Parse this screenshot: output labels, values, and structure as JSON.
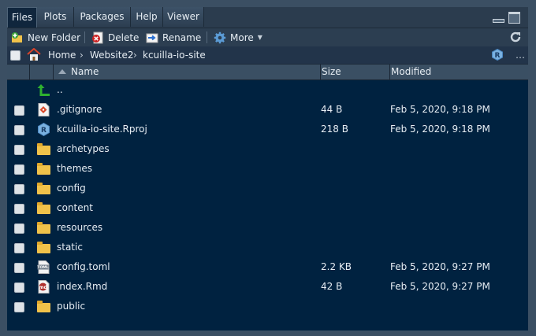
{
  "tabs": [
    {
      "label": "Files",
      "active": true
    },
    {
      "label": "Plots",
      "active": false
    },
    {
      "label": "Packages",
      "active": false
    },
    {
      "label": "Help",
      "active": false
    },
    {
      "label": "Viewer",
      "active": false
    }
  ],
  "toolbar": {
    "new_folder": "New Folder",
    "delete": "Delete",
    "rename": "Rename",
    "more": "More"
  },
  "breadcrumb": [
    "Home",
    "Website2",
    "kcuilla-io-site"
  ],
  "breadcrumb_more": "…",
  "columns": {
    "name": "Name",
    "size": "Size",
    "modified": "Modified"
  },
  "files": [
    {
      "name": "..",
      "size": "",
      "modified": "",
      "icon": "up-arrow-icon",
      "checkbox": false
    },
    {
      "name": ".gitignore",
      "size": "44 B",
      "modified": "Feb 5, 2020, 9:18 PM",
      "icon": "git-file-icon",
      "checkbox": true
    },
    {
      "name": "kcuilla-io-site.Rproj",
      "size": "218 B",
      "modified": "Feb 5, 2020, 9:18 PM",
      "icon": "rproj-file-icon",
      "checkbox": true
    },
    {
      "name": "archetypes",
      "size": "",
      "modified": "",
      "icon": "folder-icon",
      "checkbox": true
    },
    {
      "name": "themes",
      "size": "",
      "modified": "",
      "icon": "folder-icon",
      "checkbox": true
    },
    {
      "name": "config",
      "size": "",
      "modified": "",
      "icon": "folder-icon",
      "checkbox": true
    },
    {
      "name": "content",
      "size": "",
      "modified": "",
      "icon": "folder-icon",
      "checkbox": true
    },
    {
      "name": "resources",
      "size": "",
      "modified": "",
      "icon": "folder-icon",
      "checkbox": true
    },
    {
      "name": "static",
      "size": "",
      "modified": "",
      "icon": "folder-icon",
      "checkbox": true
    },
    {
      "name": "config.toml",
      "size": "2.2 KB",
      "modified": "Feb 5, 2020, 9:27 PM",
      "icon": "toml-file-icon",
      "checkbox": true
    },
    {
      "name": "index.Rmd",
      "size": "42 B",
      "modified": "Feb 5, 2020, 9:27 PM",
      "icon": "rmd-file-icon",
      "checkbox": true
    },
    {
      "name": "public",
      "size": "",
      "modified": "",
      "icon": "folder-icon",
      "checkbox": true
    }
  ],
  "colors": {
    "list_bg": "#002240",
    "panel_bg": "#3b4f63",
    "folder": "#f0c24a"
  }
}
